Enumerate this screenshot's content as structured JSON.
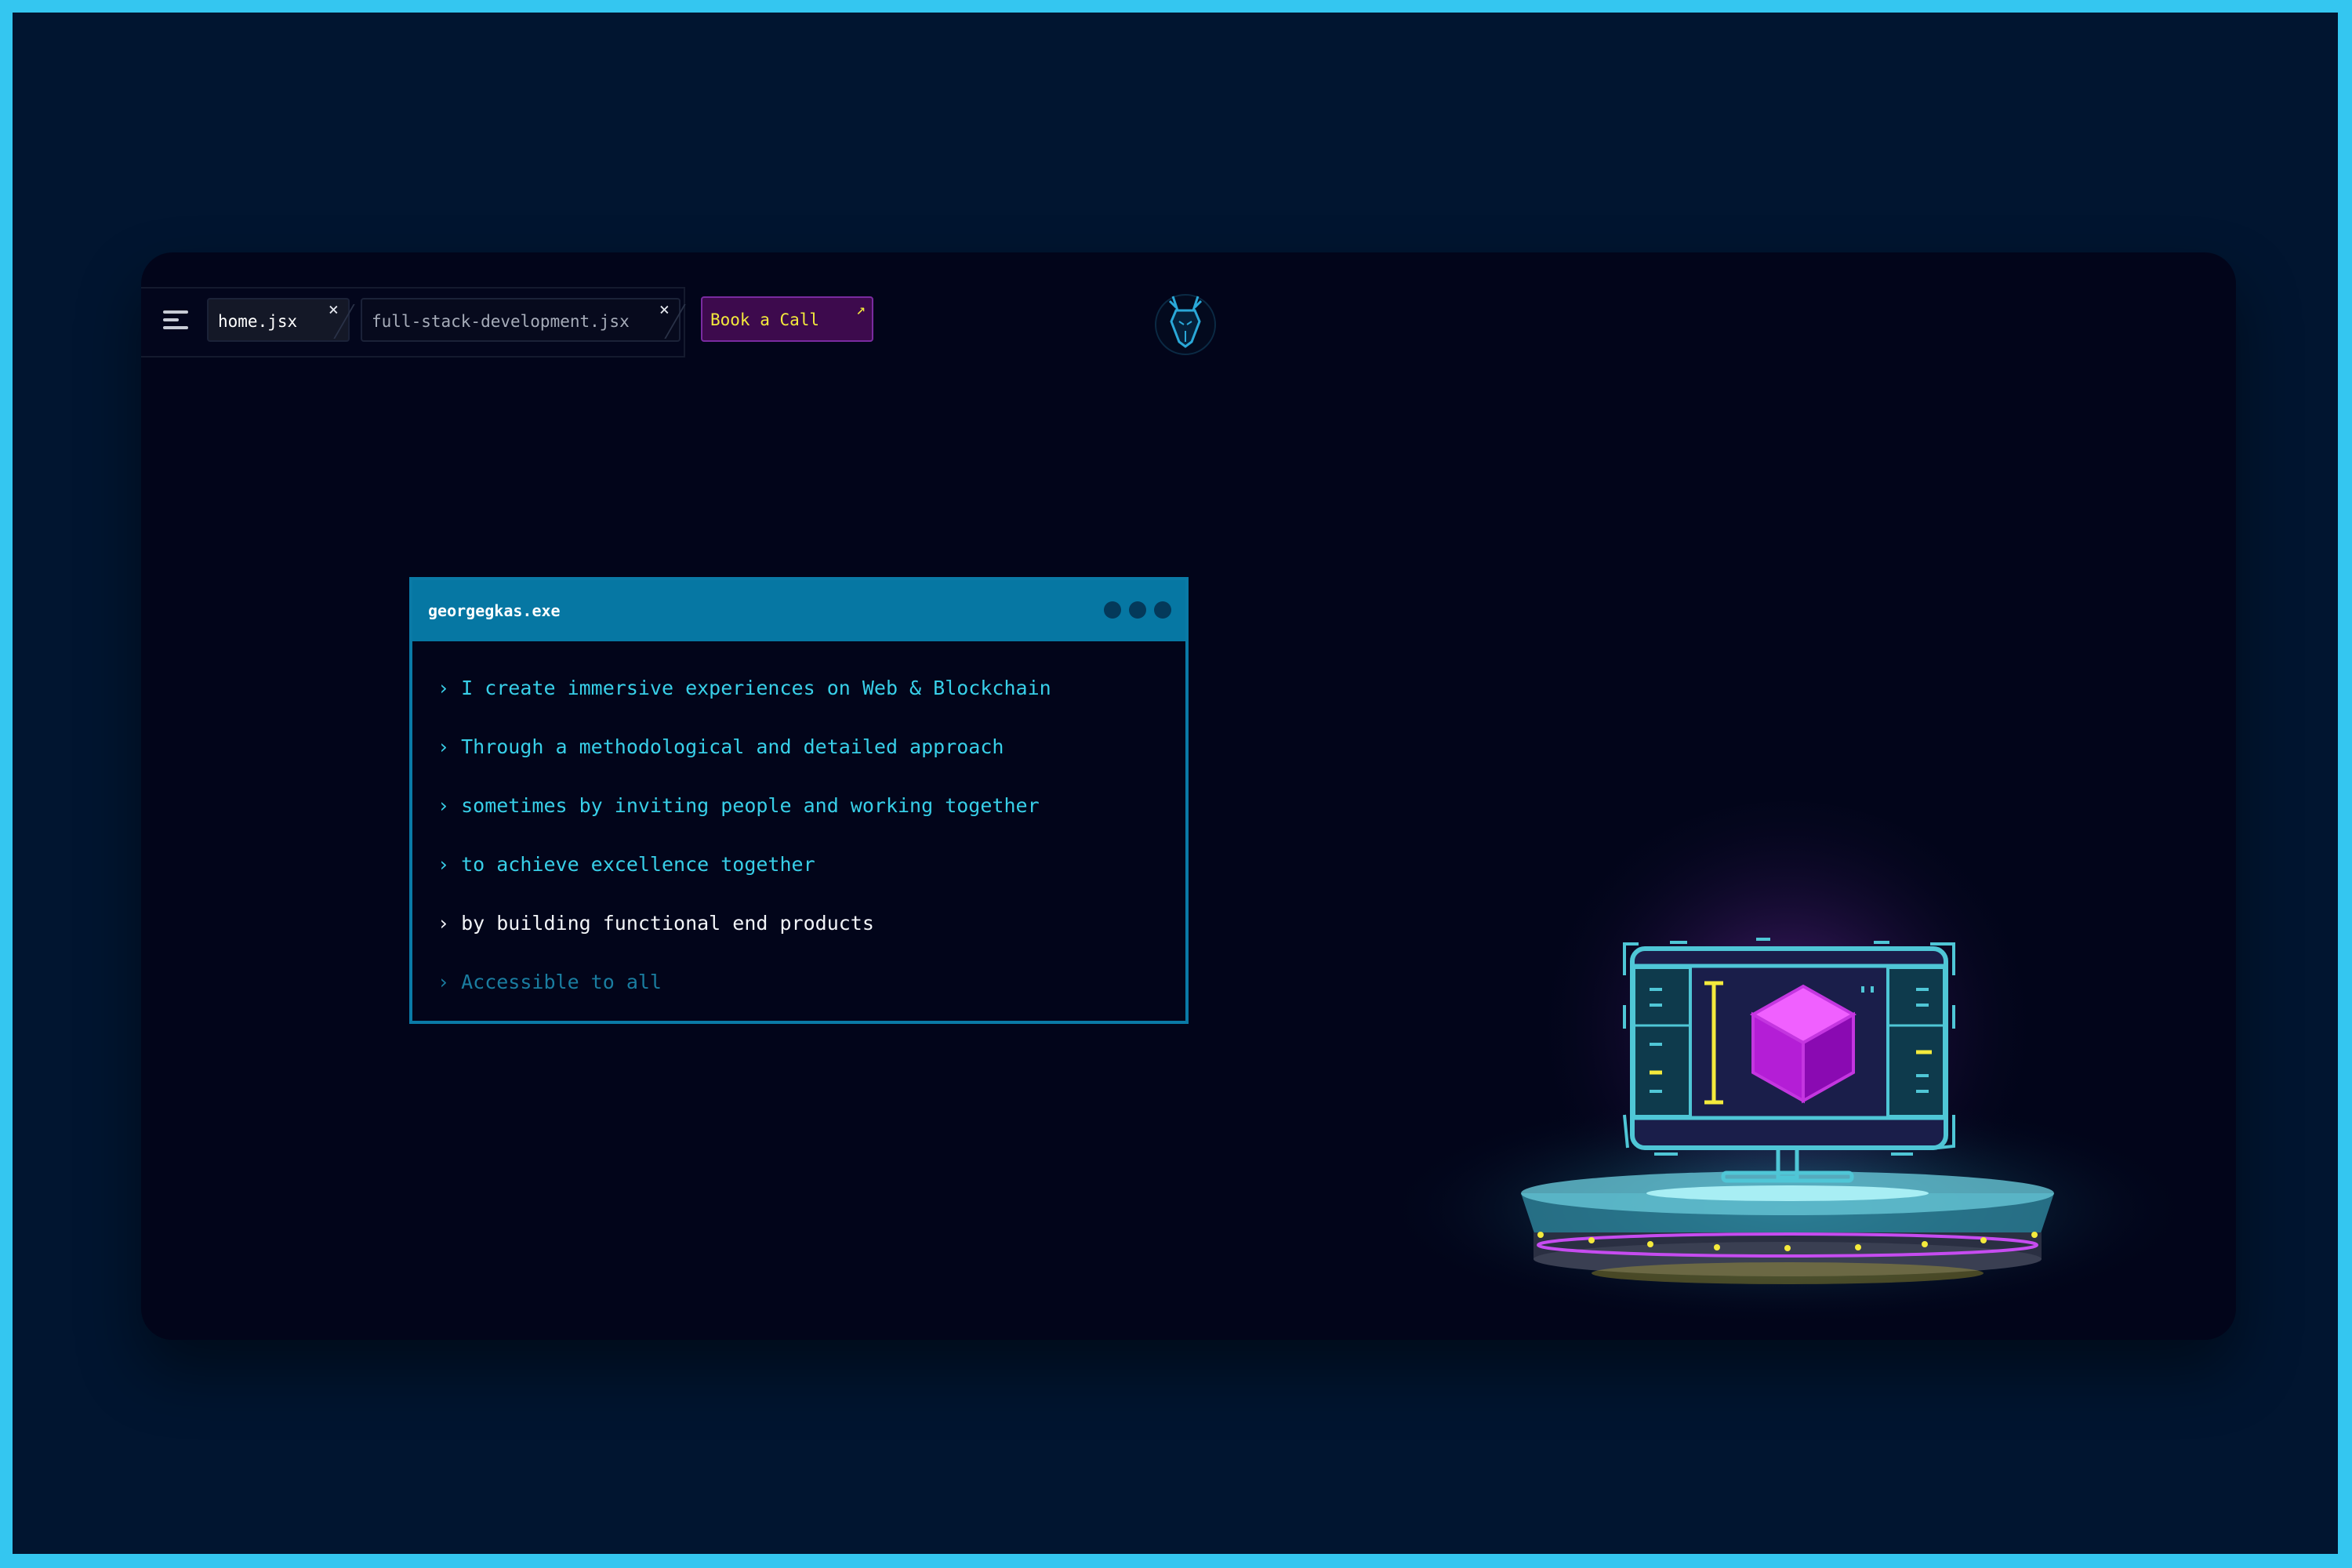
{
  "tabs": [
    {
      "label": "home.jsx",
      "close": "×"
    },
    {
      "label": "full-stack-development.jsx",
      "close": "×"
    }
  ],
  "cta": {
    "label": "Book a Call",
    "icon": "↗"
  },
  "terminal": {
    "title": "georgegkas.exe",
    "lines": [
      "› I create immersive experiences on Web & Blockchain",
      "› Through a methodological and detailed approach",
      "› sometimes by inviting people and working together",
      "› to achieve excellence together",
      "› by building functional end products",
      "› Accessible to all"
    ]
  },
  "colors": {
    "outer_border": "#34c6f0",
    "page_bg": "#011530",
    "window_bg": "#02051a",
    "terminal_header": "#0677a3",
    "accent_cyan": "#38cfe8",
    "accent_yellow": "#f4ea3c",
    "accent_magenta": "#d44cf0"
  },
  "icons": [
    "hamburger-menu-icon",
    "close-icon",
    "external-link-arrow-icon",
    "deer-logo-icon",
    "window-dot-icon"
  ]
}
